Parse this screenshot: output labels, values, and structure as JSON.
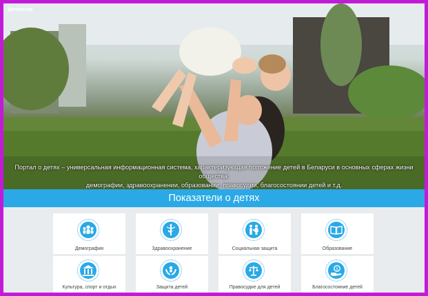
{
  "header": {
    "brand": "Детивтеле"
  },
  "hero": {
    "description_line1": "Портал о детях – универсальная информационная система, характеризующая положение детей в Беларуси в основных сферах жизни общества:",
    "description_line2": "демографии, здравоохранении, образовании, правосудии, благосостоянии детей и т.д."
  },
  "section": {
    "title": "Показатели о детях"
  },
  "indicators": [
    {
      "label": "Демография",
      "icon": "people-group-icon"
    },
    {
      "label": "Здравоохранение",
      "icon": "caduceus-icon"
    },
    {
      "label": "Социальная защита",
      "icon": "family-icon"
    },
    {
      "label": "Образование",
      "icon": "book-icon"
    },
    {
      "label": "Культура, спорт и отдых",
      "icon": "museum-icon"
    },
    {
      "label": "Защита детей",
      "icon": "protect-hands-icon"
    },
    {
      "label": "Правосудие для детей",
      "icon": "justice-icon"
    },
    {
      "label": "Благосостояние детей",
      "icon": "money-hand-icon"
    }
  ],
  "colors": {
    "accent": "#2aa9e6",
    "frame": "#c21bd8"
  }
}
